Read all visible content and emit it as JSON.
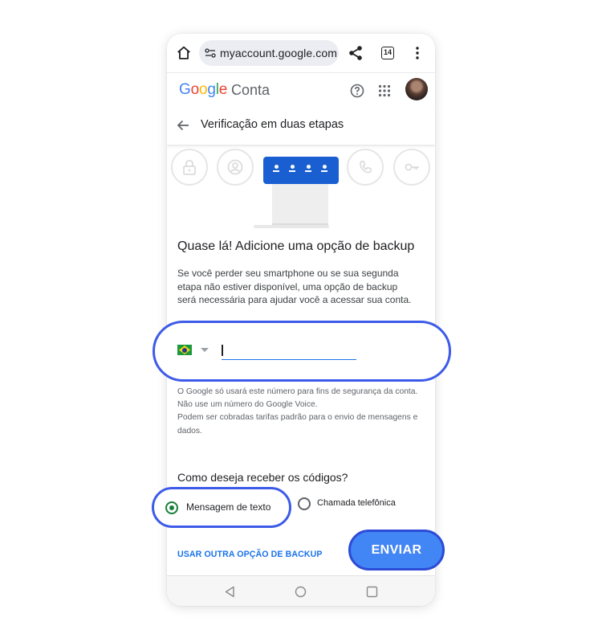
{
  "browser": {
    "url": "myaccount.google.com",
    "tab_count": "14"
  },
  "header": {
    "logo_letters": [
      "G",
      "o",
      "o",
      "g",
      "l",
      "e"
    ],
    "logo_colors": [
      "#4285f4",
      "#ea4335",
      "#fbbc05",
      "#4285f4",
      "#34a853",
      "#ea4335"
    ],
    "product": "Conta"
  },
  "page": {
    "title": "Verificação em duas etapas"
  },
  "main": {
    "section_title": "Quase lá! Adicione uma opção de backup",
    "description": "Se você perder seu smartphone ou se sua segunda etapa não estiver disponível, uma opção de backup será necessária para ajudar você a acessar sua conta.",
    "phone_input": {
      "value": "",
      "country": "BR"
    },
    "notes": [
      "O Google só usará este número para fins de segurança da conta.",
      "Não use um número do Google Voice.",
      "Podem ser cobradas tarifas padrão para o envio de mensagens e dados."
    ],
    "delivery_question": "Como deseja receber os códigos?",
    "options": [
      {
        "label": "Mensagem de texto",
        "selected": true
      },
      {
        "label": "Chamada telefônica",
        "selected": false
      }
    ],
    "alt_backup_link": "USAR OUTRA OPÇÃO DE BACKUP",
    "send_button": "ENVIAR"
  },
  "colors": {
    "highlight_outline": "#3d5be8",
    "send_button": "#4285f4",
    "link": "#1a73e8",
    "radio_selected": "#188038"
  }
}
